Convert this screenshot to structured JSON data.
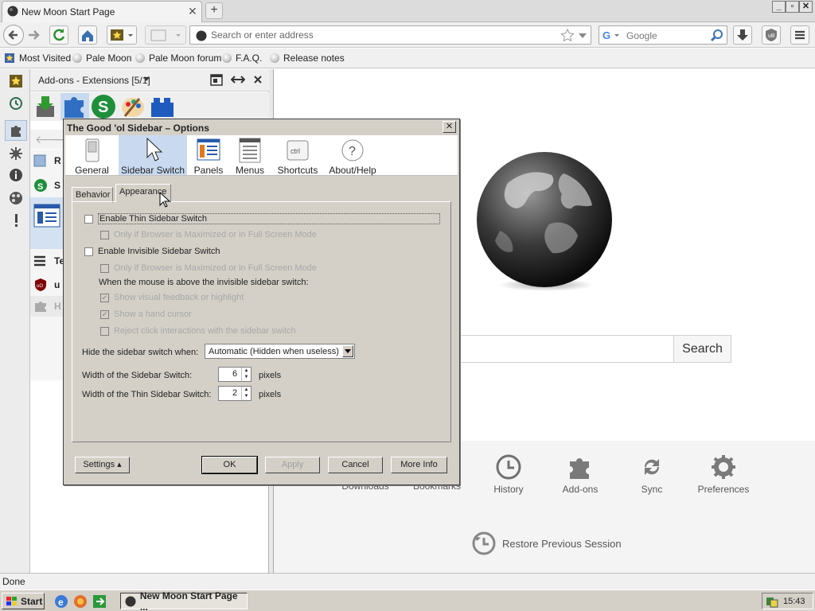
{
  "browser": {
    "tab_title": "New Moon Start Page",
    "address_placeholder": "Search or enter address",
    "search_engine": "Google",
    "bookmarks": [
      "Most Visited",
      "Pale Moon",
      "Pale Moon forum",
      "F.A.Q.",
      "Release notes"
    ]
  },
  "sidebar": {
    "title": "Add-ons - Extensions [5/1]",
    "partial_items": [
      "R",
      "S",
      "Te",
      "u",
      "H"
    ]
  },
  "page": {
    "search_button": "Search",
    "launchers": [
      "Downloads",
      "Bookmarks",
      "History",
      "Add-ons",
      "Sync",
      "Preferences"
    ],
    "restore": "Restore Previous Session"
  },
  "status": {
    "text": "Done"
  },
  "taskbar": {
    "start": "Start",
    "task": "New Moon Start Page ...",
    "clock": "15:43"
  },
  "dialog": {
    "title": "The Good 'ol Sidebar – Options",
    "panes": [
      "General",
      "Sidebar Switch",
      "Panels",
      "Menus",
      "Shortcuts",
      "About/Help"
    ],
    "selected_pane": "Sidebar Switch",
    "tabs": [
      "Behavior",
      "Appearance"
    ],
    "selected_tab": "Appearance",
    "options": {
      "thin_switch": "Enable Thin Sidebar Switch",
      "thin_only_max": "Only if Browser is Maximized or in Full Screen Mode",
      "invisible_switch": "Enable Invisible Sidebar Switch",
      "invisible_only_max": "Only if Browser is Maximized or in Full Screen Mode",
      "mouse_above": "When the mouse is above the invisible sidebar switch:",
      "visual_feedback": "Show visual feedback or highlight",
      "hand_cursor": "Show a hand cursor",
      "reject_click": "Reject click interactions with the sidebar switch"
    },
    "hide_label": "Hide the sidebar switch when:",
    "hide_value": "Automatic (Hidden when useless)",
    "width_label": "Width of the Sidebar Switch:",
    "width_value": "6",
    "thin_width_label": "Width of the Thin Sidebar Switch:",
    "thin_width_value": "2",
    "unit": "pixels",
    "buttons": {
      "settings": "Settings",
      "ok": "OK",
      "apply": "Apply",
      "cancel": "Cancel",
      "more_info": "More Info"
    }
  }
}
